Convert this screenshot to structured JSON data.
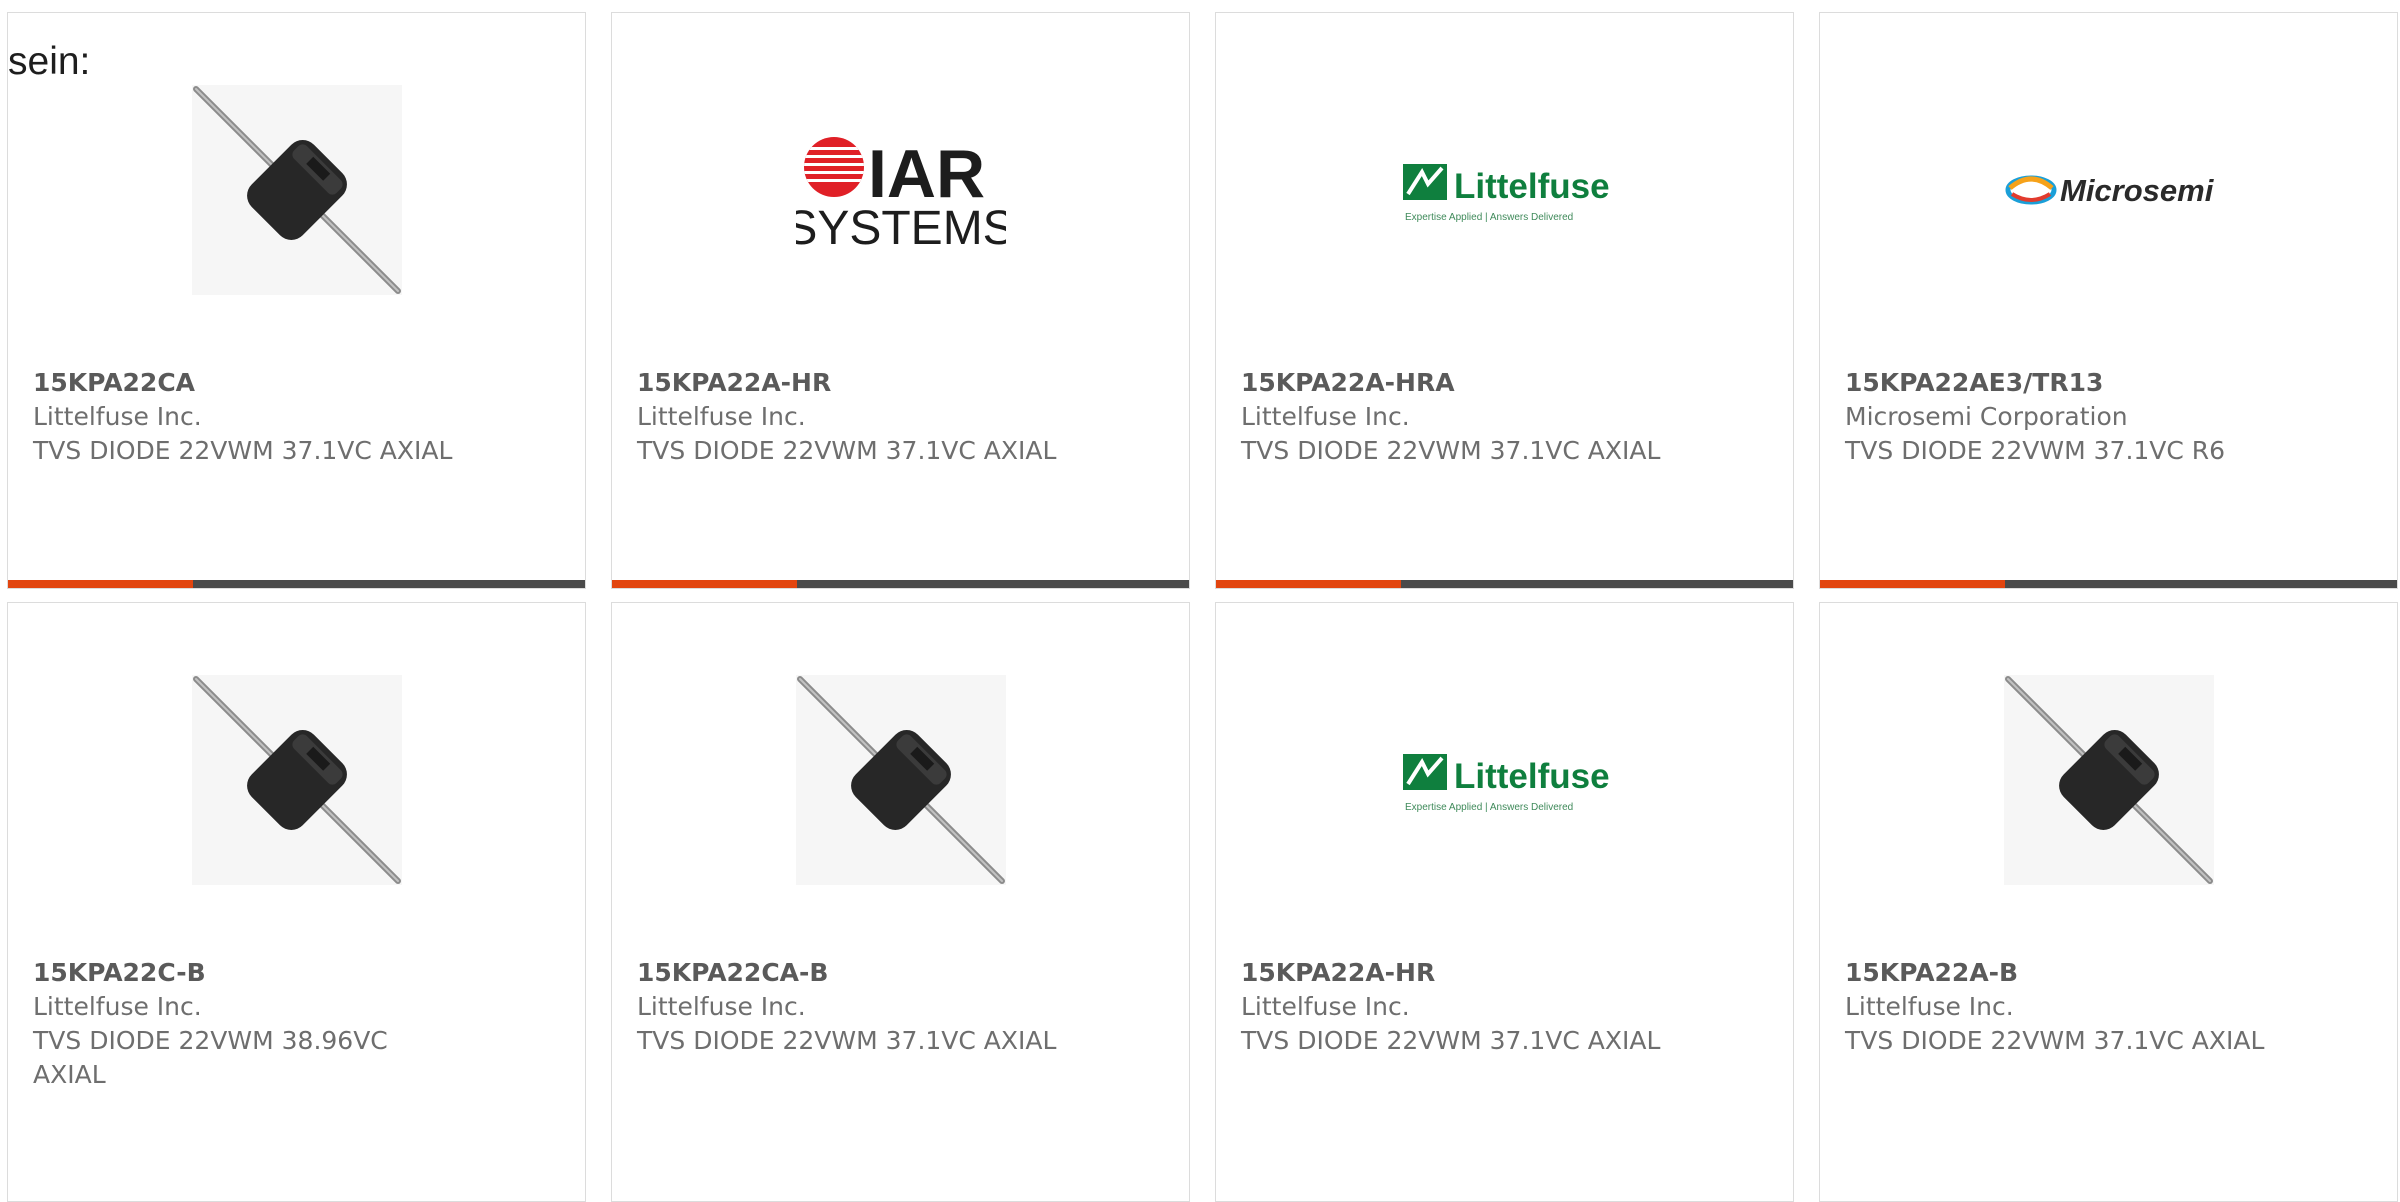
{
  "intro_text": "sein:",
  "brand_colors": {
    "accent": "#e2450f",
    "bar": "#4a4a4a",
    "littelfuse_green": "#0f7f3e",
    "iar_red": "#e02027"
  },
  "cards": [
    {
      "image": "diode-photo",
      "name": "15KPA22CA",
      "manufacturer": "Littelfuse Inc.",
      "description": "TVS DIODE 22VWM 37.1VC AXIAL",
      "progress": 0.32
    },
    {
      "image": "iar-systems-logo",
      "logo_text": [
        "IAR",
        "SYSTEMS"
      ],
      "name": "15KPA22A-HR",
      "manufacturer": "Littelfuse Inc.",
      "description": "TVS DIODE 22VWM 37.1VC AXIAL",
      "progress": 0.32
    },
    {
      "image": "littelfuse-logo",
      "logo_text": [
        "Littelfuse",
        "Expertise Applied | Answers Delivered"
      ],
      "name": "15KPA22A-HRA",
      "manufacturer": "Littelfuse Inc.",
      "description": "TVS DIODE 22VWM 37.1VC AXIAL",
      "progress": 0.32
    },
    {
      "image": "microsemi-logo",
      "logo_text": [
        "Microsemi"
      ],
      "name": "15KPA22AE3/TR13",
      "manufacturer": "Microsemi Corporation",
      "description": "TVS DIODE 22VWM 37.1VC R6",
      "progress": 0.32
    },
    {
      "image": "diode-photo",
      "name": "15KPA22C-B",
      "manufacturer": "Littelfuse Inc.",
      "description": "TVS DIODE 22VWM 38.96VC AXIAL"
    },
    {
      "image": "diode-photo",
      "name": "15KPA22CA-B",
      "manufacturer": "Littelfuse Inc.",
      "description": "TVS DIODE 22VWM 37.1VC AXIAL"
    },
    {
      "image": "littelfuse-logo",
      "logo_text": [
        "Littelfuse",
        "Expertise Applied | Answers Delivered"
      ],
      "name": "15KPA22A-HR",
      "manufacturer": "Littelfuse Inc.",
      "description": "TVS DIODE 22VWM 37.1VC AXIAL"
    },
    {
      "image": "diode-photo",
      "name": "15KPA22A-B",
      "manufacturer": "Littelfuse Inc.",
      "description": "TVS DIODE 22VWM 37.1VC AXIAL"
    }
  ]
}
